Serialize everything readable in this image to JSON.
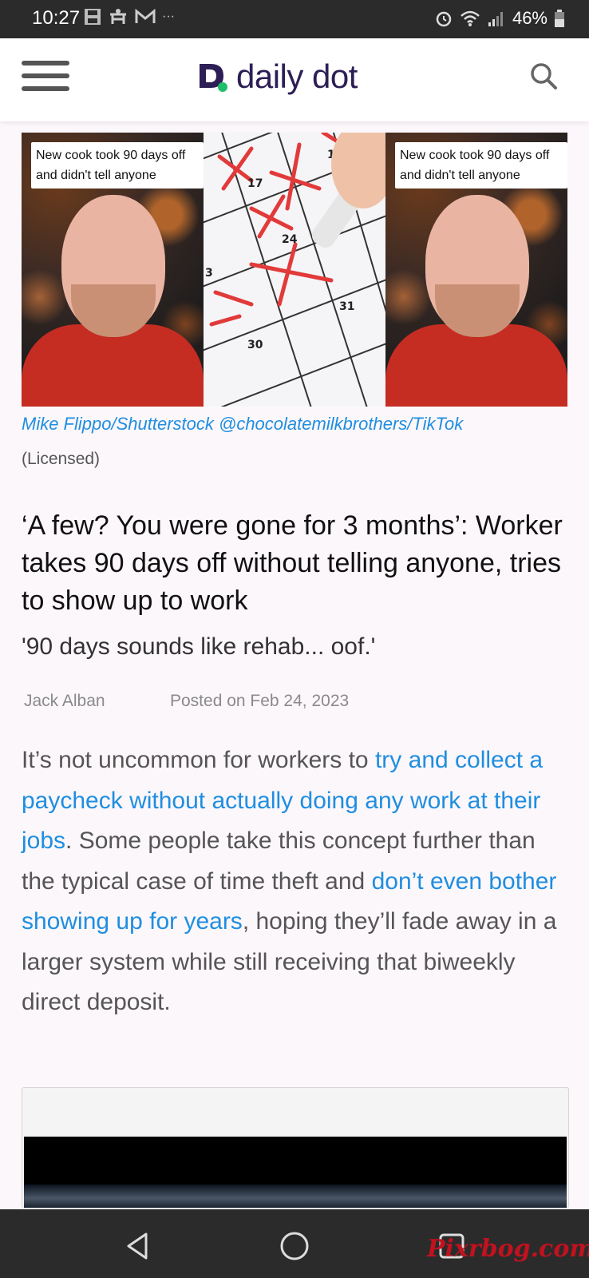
{
  "status_bar": {
    "time": "10:27",
    "more": "···",
    "battery": "46%"
  },
  "header": {
    "logo_text": "daily dot"
  },
  "hero": {
    "caption_left": "New cook took 90 days off and didn't tell anyone",
    "caption_right": "New cook took 90 days off and didn't tell anyone",
    "calendar_numbers": [
      "17",
      "19",
      "24",
      "31",
      "30",
      "3"
    ]
  },
  "credit": {
    "text": "Mike Flippo/Shutterstock @chocolatemilkbrothers/TikTok",
    "license": "(Licensed)"
  },
  "article": {
    "title": "‘A few? You were gone for 3 months’: Worker takes 90 days off without telling anyone, tries to show up to work",
    "subtitle": "'90 days sounds like rehab... oof.'",
    "author": "Jack Alban",
    "posted": "Posted on Feb 24, 2023",
    "body_1": "It’s not uncommon for workers to ",
    "link_1": "try and collect a paycheck without actually doing any work at their jobs",
    "body_2": ". Some people take this concept further than the typical case of time theft and ",
    "link_2": "don’t even bother showing up for years",
    "body_3": ", hoping they’ll fade away in a larger system while still receiving that biweekly direct deposit."
  },
  "watermark": "Pixrbog.com",
  "colors": {
    "link": "#1f8ee0",
    "status_bar": "#2b2b2b",
    "logo_dark": "#2d1f55",
    "logo_green": "#1fbf6a"
  }
}
